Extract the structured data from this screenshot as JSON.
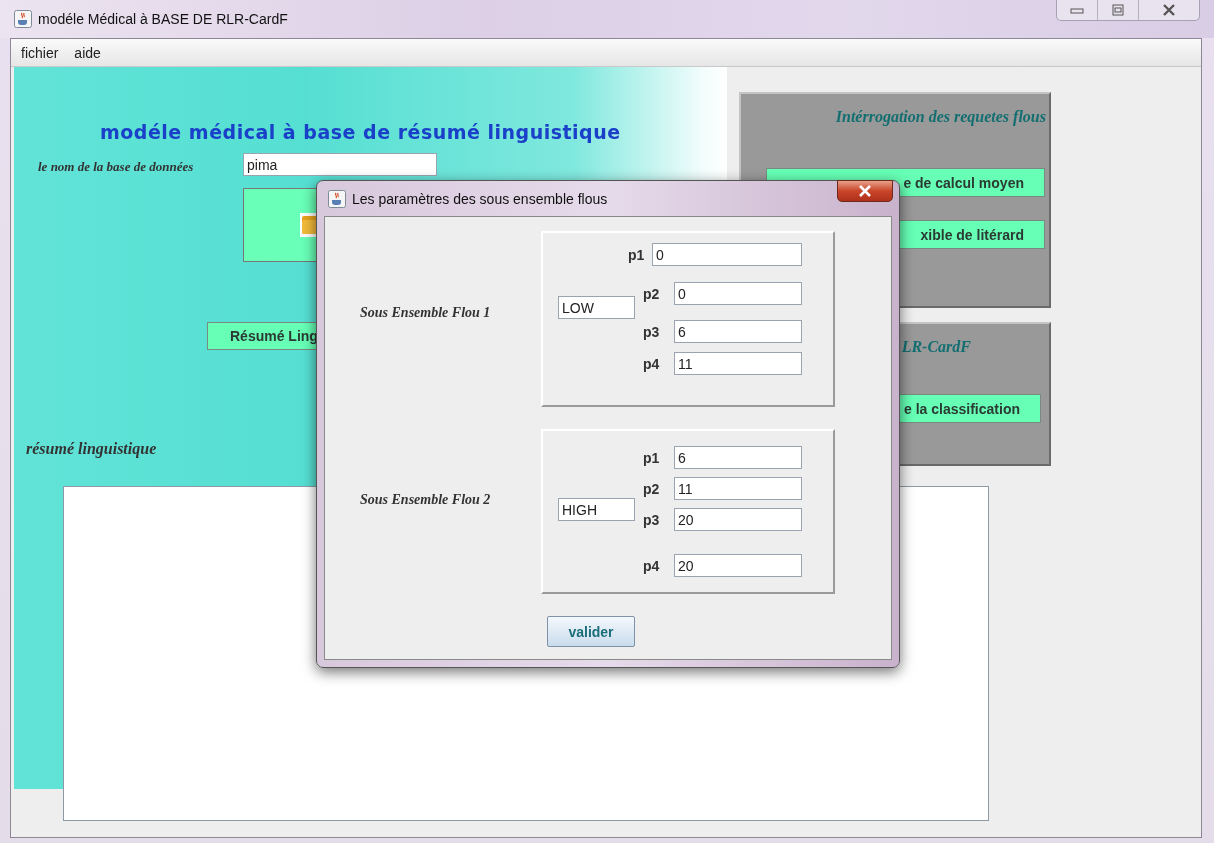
{
  "window": {
    "title": "modéle Médical à BASE DE RLR-CardF"
  },
  "menu": [
    "fichier",
    "aide"
  ],
  "main": {
    "heading": "modéle médical à base de résumé linguistique",
    "database_label": "le nom de la base de données",
    "database_value": "pima",
    "summary_button": "Résumé Ling",
    "summary_label": "résumé linguistique"
  },
  "panels": [
    {
      "title": "Intérrogation des requetes flous",
      "buttons": [
        "e de calcul moyen",
        "xible de litérard"
      ]
    },
    {
      "title": "LR-CardF",
      "buttons": [
        "e la classification"
      ]
    }
  ],
  "dialog": {
    "title": "Les paramètres des sous ensemble flous",
    "sets": [
      {
        "label": "Sous Ensemble Flou 1",
        "name": "LOW",
        "params": [
          {
            "label": "p1",
            "value": "0"
          },
          {
            "label": "p2",
            "value": "0"
          },
          {
            "label": "p3",
            "value": "6"
          },
          {
            "label": "p4",
            "value": "11"
          }
        ]
      },
      {
        "label": "Sous Ensemble Flou 2",
        "name": "HIGH",
        "params": [
          {
            "label": "p1",
            "value": "6"
          },
          {
            "label": "p2",
            "value": "11"
          },
          {
            "label": "p3",
            "value": "20"
          },
          {
            "label": "p4",
            "value": "20"
          }
        ]
      }
    ],
    "button": "valider"
  }
}
